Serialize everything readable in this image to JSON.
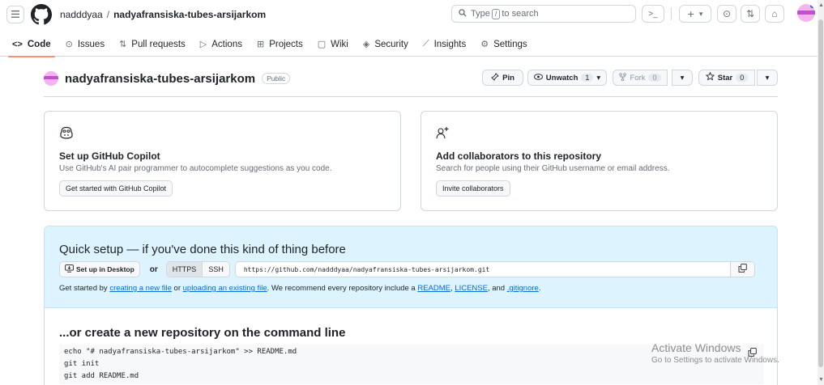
{
  "header": {
    "owner": "nadddyaa",
    "separator": "/",
    "repo": "nadyafransiska-tubes-arsijarkom",
    "search_prefix": "Type",
    "search_key": "/",
    "search_suffix": "to search",
    "command_icon": ">_",
    "plus_icon": "+",
    "caret_icon": "▾",
    "issues_icon": "⊙",
    "pr_icon": "⇅",
    "inbox_icon": "⌂"
  },
  "nav": {
    "items": [
      {
        "icon": "<>",
        "label": "Code",
        "active": true
      },
      {
        "icon": "⊙",
        "label": "Issues"
      },
      {
        "icon": "⇅",
        "label": "Pull requests"
      },
      {
        "icon": "▷",
        "label": "Actions"
      },
      {
        "icon": "⊞",
        "label": "Projects"
      },
      {
        "icon": "▢",
        "label": "Wiki"
      },
      {
        "icon": "◈",
        "label": "Security"
      },
      {
        "icon": "⟋",
        "label": "Insights"
      },
      {
        "icon": "⚙",
        "label": "Settings"
      }
    ]
  },
  "repo": {
    "name": "nadyafransiska-tubes-arsijarkom",
    "visibility": "Public",
    "pin_label": "Pin",
    "unwatch_label": "Unwatch",
    "unwatch_count": "1",
    "fork_label": "Fork",
    "fork_count": "0",
    "star_label": "Star",
    "star_count": "0"
  },
  "cards": {
    "copilot": {
      "title": "Set up GitHub Copilot",
      "desc": "Use GitHub's AI pair programmer to autocomplete suggestions as you code.",
      "button": "Get started with GitHub Copilot"
    },
    "collab": {
      "title": "Add collaborators to this repository",
      "desc": "Search for people using their GitHub username or email address.",
      "button": "Invite collaborators"
    }
  },
  "quick_setup": {
    "title": "Quick setup — if you've done this kind of thing before",
    "desktop_button": "Set up in Desktop",
    "or": "or",
    "https": "HTTPS",
    "ssh": "SSH",
    "url": "https://github.com/nadddyaa/nadyafransiska-tubes-arsijarkom.git",
    "help_prefix": "Get started by",
    "link_new_file": "creating a new file",
    "help_or": "or",
    "link_upload": "uploading an existing file",
    "help_mid": ". We recommend every repository include a",
    "link_readme": "README",
    "comma1": ",",
    "link_license": "LICENSE",
    "help_and": ", and",
    "link_gitignore": ".gitignore",
    "period": "."
  },
  "command_line": {
    "title": "...or create a new repository on the command line",
    "lines": [
      "echo \"# nadyafransiska-tubes-arsijarkom\" >> README.md",
      "git init",
      "git add README.md"
    ]
  },
  "watermark": {
    "line1": "Activate Windows",
    "line2": "Go to Settings to activate Windows."
  }
}
